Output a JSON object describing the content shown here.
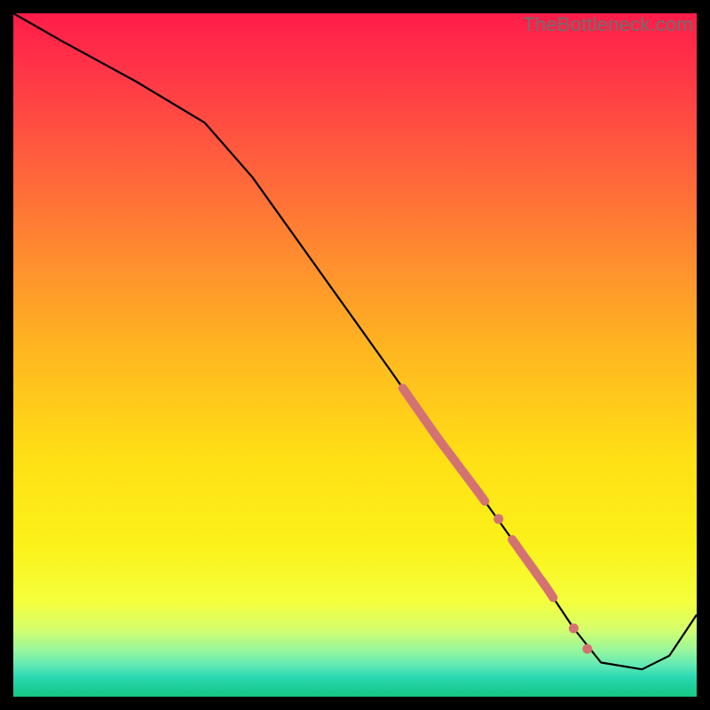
{
  "watermark": "TheBottleneck.com",
  "colors": {
    "band": "#d47272",
    "curve": "#000000",
    "frame": "#000000"
  },
  "chart_data": {
    "type": "line",
    "title": "",
    "xlabel": "",
    "ylabel": "",
    "xlim": [
      0,
      100
    ],
    "ylim": [
      0,
      100
    ],
    "background_gradient": {
      "top": "red",
      "upper_mid": "orange",
      "mid": "yellow",
      "bottom": "green",
      "meaning": "vertical heat scale; green = best (low)"
    },
    "series": [
      {
        "name": "bottleneck-curve",
        "x": [
          0,
          7,
          18,
          28,
          35,
          45,
          55,
          62,
          68,
          73,
          78,
          82,
          86,
          92,
          96,
          100
        ],
        "y": [
          100,
          96,
          90,
          84,
          76,
          62,
          48,
          38,
          30,
          23,
          16,
          10,
          5,
          4,
          6,
          12
        ]
      }
    ],
    "highlighted_segments": [
      {
        "name": "band-primary",
        "x_range": [
          57,
          69
        ],
        "y_range": [
          45,
          28
        ],
        "note": "thick salmon segment on descending slope"
      },
      {
        "name": "band-secondary",
        "x_range": [
          73,
          79
        ],
        "y_range": [
          23,
          14
        ],
        "note": "smaller salmon segment near bottom"
      }
    ],
    "highlighted_points": [
      {
        "x": 71,
        "y": 26
      },
      {
        "x": 82,
        "y": 10
      },
      {
        "x": 84,
        "y": 7
      }
    ],
    "grid": false,
    "legend": false
  }
}
